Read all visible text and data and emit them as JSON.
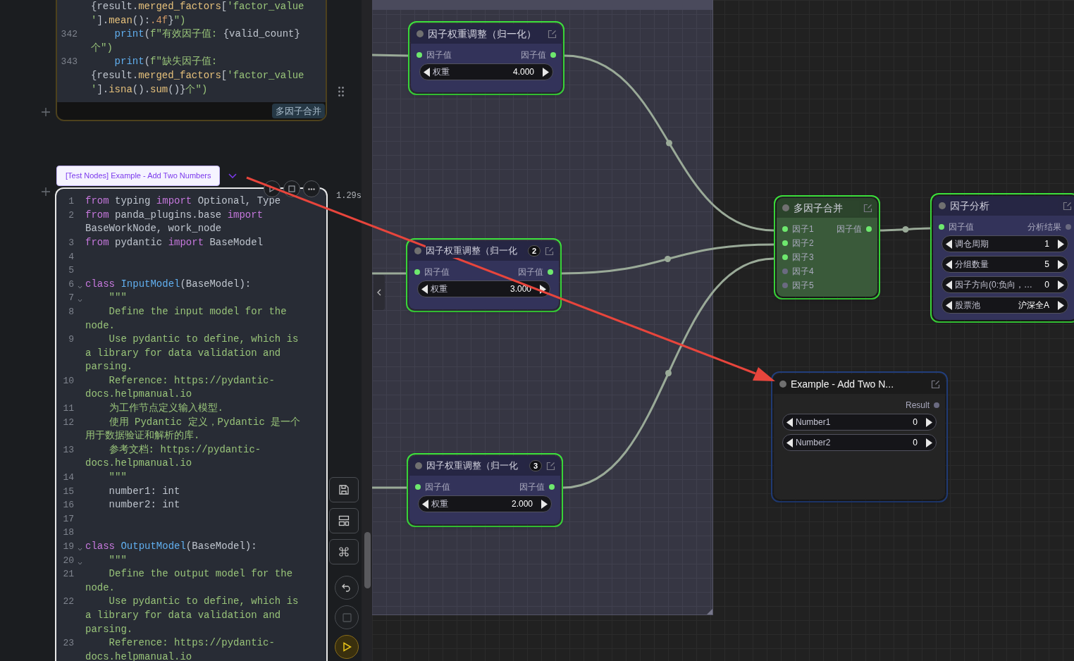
{
  "code_cells": [
    {
      "tag": "多因子合并",
      "lines": [
        {
          "fold": false,
          "tokens": [
            {
              "kind": "plain",
              "text": "{result."
            },
            {
              "kind": "attr",
              "text": "merged_factors"
            },
            {
              "kind": "plain",
              "text": "["
            },
            {
              "kind": "str",
              "text": "'factor_value'"
            },
            {
              "kind": "plain",
              "text": "]."
            },
            {
              "kind": "attr",
              "text": "mean"
            },
            {
              "kind": "plain",
              "text": "():"
            },
            {
              "kind": "num",
              "text": ".4f"
            },
            {
              "kind": "plain",
              "text": "}"
            },
            {
              "kind": "str",
              "text": "\")"
            }
          ]
        },
        {
          "number": "342",
          "fold": false,
          "tokens": [
            {
              "kind": "fn",
              "text": "    print"
            },
            {
              "kind": "plain",
              "text": "("
            },
            {
              "kind": "str",
              "text": "f\"有效因子值: "
            },
            {
              "kind": "plain",
              "text": "{valid_count}"
            },
            {
              "kind": "str",
              "text": "个\")"
            }
          ]
        },
        {
          "number": "343",
          "fold": false,
          "tokens": [
            {
              "kind": "fn",
              "text": "    print"
            },
            {
              "kind": "plain",
              "text": "("
            },
            {
              "kind": "str",
              "text": "f\"缺失因子值: "
            },
            {
              "kind": "plain",
              "text": "{result."
            },
            {
              "kind": "attr",
              "text": "merged_factors"
            },
            {
              "kind": "plain",
              "text": "["
            },
            {
              "kind": "str",
              "text": "'factor_value'"
            },
            {
              "kind": "plain",
              "text": "]."
            },
            {
              "kind": "attr",
              "text": "isna"
            },
            {
              "kind": "plain",
              "text": "()."
            },
            {
              "kind": "attr",
              "text": "sum"
            },
            {
              "kind": "plain",
              "text": "()}"
            },
            {
              "kind": "str",
              "text": "个\")"
            }
          ]
        }
      ]
    },
    {
      "title": "[Test Nodes] Example - Add Two Numbers",
      "duration": "1.29s",
      "lines": [
        {
          "number": "1",
          "fold": false,
          "tokens": [
            {
              "kind": "kw",
              "text": "from"
            },
            {
              "kind": "plain",
              "text": " typing "
            },
            {
              "kind": "kw",
              "text": "import"
            },
            {
              "kind": "plain",
              "text": " Optional, Type"
            }
          ]
        },
        {
          "number": "2",
          "fold": false,
          "tokens": [
            {
              "kind": "kw",
              "text": "from"
            },
            {
              "kind": "plain",
              "text": " panda_plugins.base "
            },
            {
              "kind": "kw",
              "text": "import"
            },
            {
              "kind": "plain",
              "text": " BaseWorkNode, work_node"
            }
          ]
        },
        {
          "number": "3",
          "fold": false,
          "tokens": [
            {
              "kind": "kw",
              "text": "from"
            },
            {
              "kind": "plain",
              "text": " pydantic "
            },
            {
              "kind": "kw",
              "text": "import"
            },
            {
              "kind": "plain",
              "text": " BaseModel"
            }
          ]
        },
        {
          "number": "4",
          "fold": false
        },
        {
          "number": "5",
          "fold": false
        },
        {
          "number": "6",
          "fold": true,
          "tokens": [
            {
              "kind": "kw",
              "text": "class "
            },
            {
              "kind": "fn",
              "text": "InputModel"
            },
            {
              "kind": "plain",
              "text": "(BaseModel):"
            }
          ]
        },
        {
          "number": "7",
          "fold": true,
          "tokens": [
            {
              "kind": "str",
              "text": "    \"\"\""
            }
          ]
        },
        {
          "number": "8",
          "fold": false,
          "tokens": [
            {
              "kind": "str",
              "text": "    Define the input model for the node."
            }
          ]
        },
        {
          "number": "9",
          "fold": false,
          "tokens": [
            {
              "kind": "str",
              "text": "    Use pydantic to define, which is a library for data validation and parsing."
            }
          ]
        },
        {
          "number": "10",
          "fold": false,
          "tokens": [
            {
              "kind": "str",
              "text": "    Reference: https://pydantic-docs.helpmanual.io"
            }
          ]
        },
        {
          "number": "11",
          "fold": false,
          "tokens": [
            {
              "kind": "str",
              "text": "    为工作节点定义输入模型."
            }
          ]
        },
        {
          "number": "12",
          "fold": false,
          "tokens": [
            {
              "kind": "str",
              "text": "    使用 Pydantic 定义，Pydantic 是一个用于数据验证和解析的库."
            }
          ]
        },
        {
          "number": "13",
          "fold": false,
          "tokens": [
            {
              "kind": "str",
              "text": "    参考文档: https://pydantic-docs.helpmanual.io"
            }
          ]
        },
        {
          "number": "14",
          "fold": false,
          "tokens": [
            {
              "kind": "str",
              "text": "    \"\"\""
            }
          ]
        },
        {
          "number": "15",
          "fold": false,
          "tokens": [
            {
              "kind": "plain",
              "text": "    number1: int"
            }
          ]
        },
        {
          "number": "16",
          "fold": false,
          "tokens": [
            {
              "kind": "plain",
              "text": "    number2: int"
            }
          ]
        },
        {
          "number": "17",
          "fold": false
        },
        {
          "number": "18",
          "fold": false
        },
        {
          "number": "19",
          "fold": true,
          "tokens": [
            {
              "kind": "kw",
              "text": "class "
            },
            {
              "kind": "fn",
              "text": "OutputModel"
            },
            {
              "kind": "plain",
              "text": "(BaseModel):"
            }
          ]
        },
        {
          "number": "20",
          "fold": true,
          "tokens": [
            {
              "kind": "str",
              "text": "    \"\"\""
            }
          ]
        },
        {
          "number": "21",
          "fold": false,
          "tokens": [
            {
              "kind": "str",
              "text": "    Define the output model for the node."
            }
          ]
        },
        {
          "number": "22",
          "fold": false,
          "tokens": [
            {
              "kind": "str",
              "text": "    Use pydantic to define, which is a library for data validation and parsing."
            }
          ]
        },
        {
          "number": "23",
          "fold": false,
          "tokens": [
            {
              "kind": "str",
              "text": "    Reference: https://pydantic-docs.helpmanual.io"
            }
          ]
        }
      ]
    }
  ],
  "canvas": {
    "nodes": [
      {
        "title": "因子权重调整（归一化）",
        "selected": true,
        "color": "#33335a",
        "inputs": [
          {
            "label": "因子值",
            "connected": true
          }
        ],
        "outputs": [
          {
            "label": "因子值",
            "connected": true
          }
        ],
        "widgets": [
          {
            "label": "权重",
            "value": "4.000"
          }
        ]
      },
      {
        "title": "因子权重调整（归一化",
        "badge": "2",
        "selected": true,
        "color": "#33335a",
        "inputs": [
          {
            "label": "因子值",
            "connected": true
          }
        ],
        "outputs": [
          {
            "label": "因子值",
            "connected": true
          }
        ],
        "widgets": [
          {
            "label": "权重",
            "value": "3.000"
          }
        ]
      },
      {
        "title": "因子权重调整（归一化",
        "badge": "3",
        "selected": true,
        "color": "#33335a",
        "inputs": [
          {
            "label": "因子值",
            "connected": true
          }
        ],
        "outputs": [
          {
            "label": "因子值",
            "connected": true
          }
        ],
        "widgets": [
          {
            "label": "权重",
            "value": "2.000"
          }
        ]
      },
      {
        "title": "多因子合并",
        "selected": true,
        "color": "#3a5a3a",
        "inputs": [
          {
            "label": "因子1",
            "connected": true
          },
          {
            "label": "因子2",
            "connected": true
          },
          {
            "label": "因子3",
            "connected": true
          },
          {
            "label": "因子4",
            "connected": false
          },
          {
            "label": "因子5",
            "connected": false
          }
        ],
        "outputs": [
          {
            "label": "因子值",
            "connected": true
          }
        ]
      },
      {
        "title": "因子分析",
        "selected": true,
        "color": "#33335a",
        "inputs": [
          {
            "label": "因子值",
            "connected": true
          }
        ],
        "outputs": [
          {
            "label": "分析结果",
            "connected": false
          }
        ],
        "widgets": [
          {
            "label": "调仓周期",
            "value": "1"
          },
          {
            "label": "分组数量",
            "value": "5"
          },
          {
            "label": "因子方向(0:负向，…",
            "value": "0"
          },
          {
            "label": "股票池",
            "value": "沪深全A"
          }
        ]
      },
      {
        "title": "Example - Add Two N...",
        "selected": false,
        "color": "#242424",
        "outputs": [
          {
            "label": "Result",
            "connected": false
          }
        ],
        "widgets": [
          {
            "label": "Number1",
            "value": "0"
          },
          {
            "label": "Number2",
            "value": "0"
          }
        ]
      }
    ]
  }
}
